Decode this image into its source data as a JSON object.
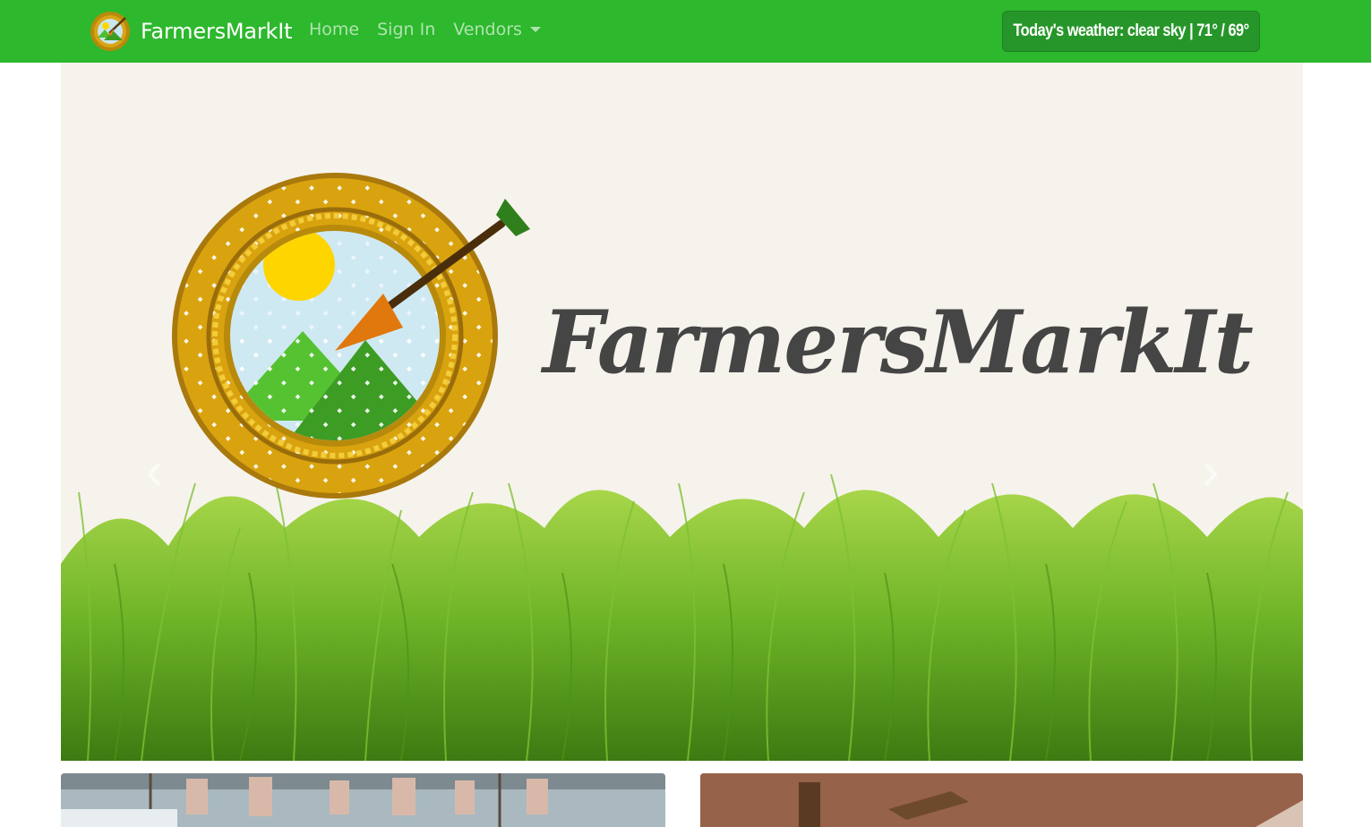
{
  "navbar": {
    "brand": "FarmersMarkIt",
    "links": [
      {
        "label": "Home"
      },
      {
        "label": "Sign In"
      },
      {
        "label": "Vendors",
        "dropdown": true
      }
    ],
    "weather": "Today's weather: clear sky | 71° / 69°",
    "bg_color": "#2db82d"
  },
  "hero": {
    "logo_text": "FarmersMarkIt",
    "controls": {
      "prev_icon": "chevron-left-icon",
      "next_icon": "chevron-right-icon"
    }
  },
  "cards": [
    {
      "name": "market-stall-image"
    },
    {
      "name": "wooden-produce-image"
    }
  ]
}
